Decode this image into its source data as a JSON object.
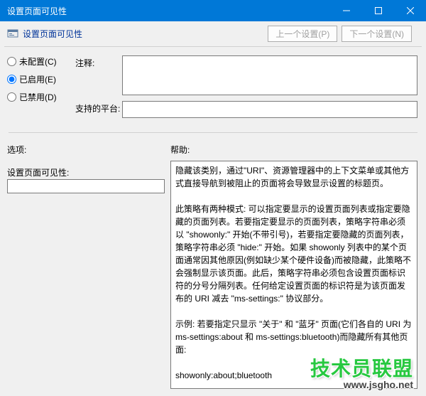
{
  "window": {
    "title": "设置页面可见性",
    "subhead": "设置页面可见性"
  },
  "nav": {
    "prev": "上一个设置(P)",
    "next": "下一个设置(N)"
  },
  "radios": {
    "not_configured": "未配置(C)",
    "enabled": "已启用(E)",
    "disabled": "已禁用(D)",
    "selected": "enabled"
  },
  "labels": {
    "comment": "注释:",
    "platforms": "支持的平台:",
    "options": "选项:",
    "help": "帮助:",
    "group": "设置页面可见性:"
  },
  "fields": {
    "comment": "",
    "platforms": "",
    "visibility": ""
  },
  "help_text": "隐藏该类别，通过\"URI\"、资源管理器中的上下文菜单或其他方式直接导航到被阻止的页面将会导致显示设置的标题页。\n\n此策略有两种模式: 可以指定要显示的设置页面列表或指定要隐藏的页面列表。若要指定要显示的页面列表，策略字符串必须以 \"showonly:\" 开始(不带引号)，若要指定要隐藏的页面列表，策略字符串必须 \"hide:\" 开始。如果 showonly 列表中的某个页面通常因其他原因(例如缺少某个硬件设备)而被隐藏，此策略不会强制显示该页面。此后，策略字符串必须包含设置页面标识符的分号分隔列表。任何给定设置页面的标识符是为该页面发布的 URI 减去 \"ms-settings:\" 协议部分。\n\n示例: 若要指定只显示 \"关于\" 和 \"蓝牙\" 页面(它们各自的 URI 为 ms-settings:about 和 ms-settings:bluetooth)而隐藏所有其他页面:\n\nshowonly:about;bluetooth\n\n示例: 若要指定只隐藏 \"蓝牙\" 页面(其 URI 为 ms-settings:bluetooth):\n\nhide:bluetooth",
  "watermark": {
    "brand": "技术员联盟",
    "url": "www.jsgho.net"
  }
}
